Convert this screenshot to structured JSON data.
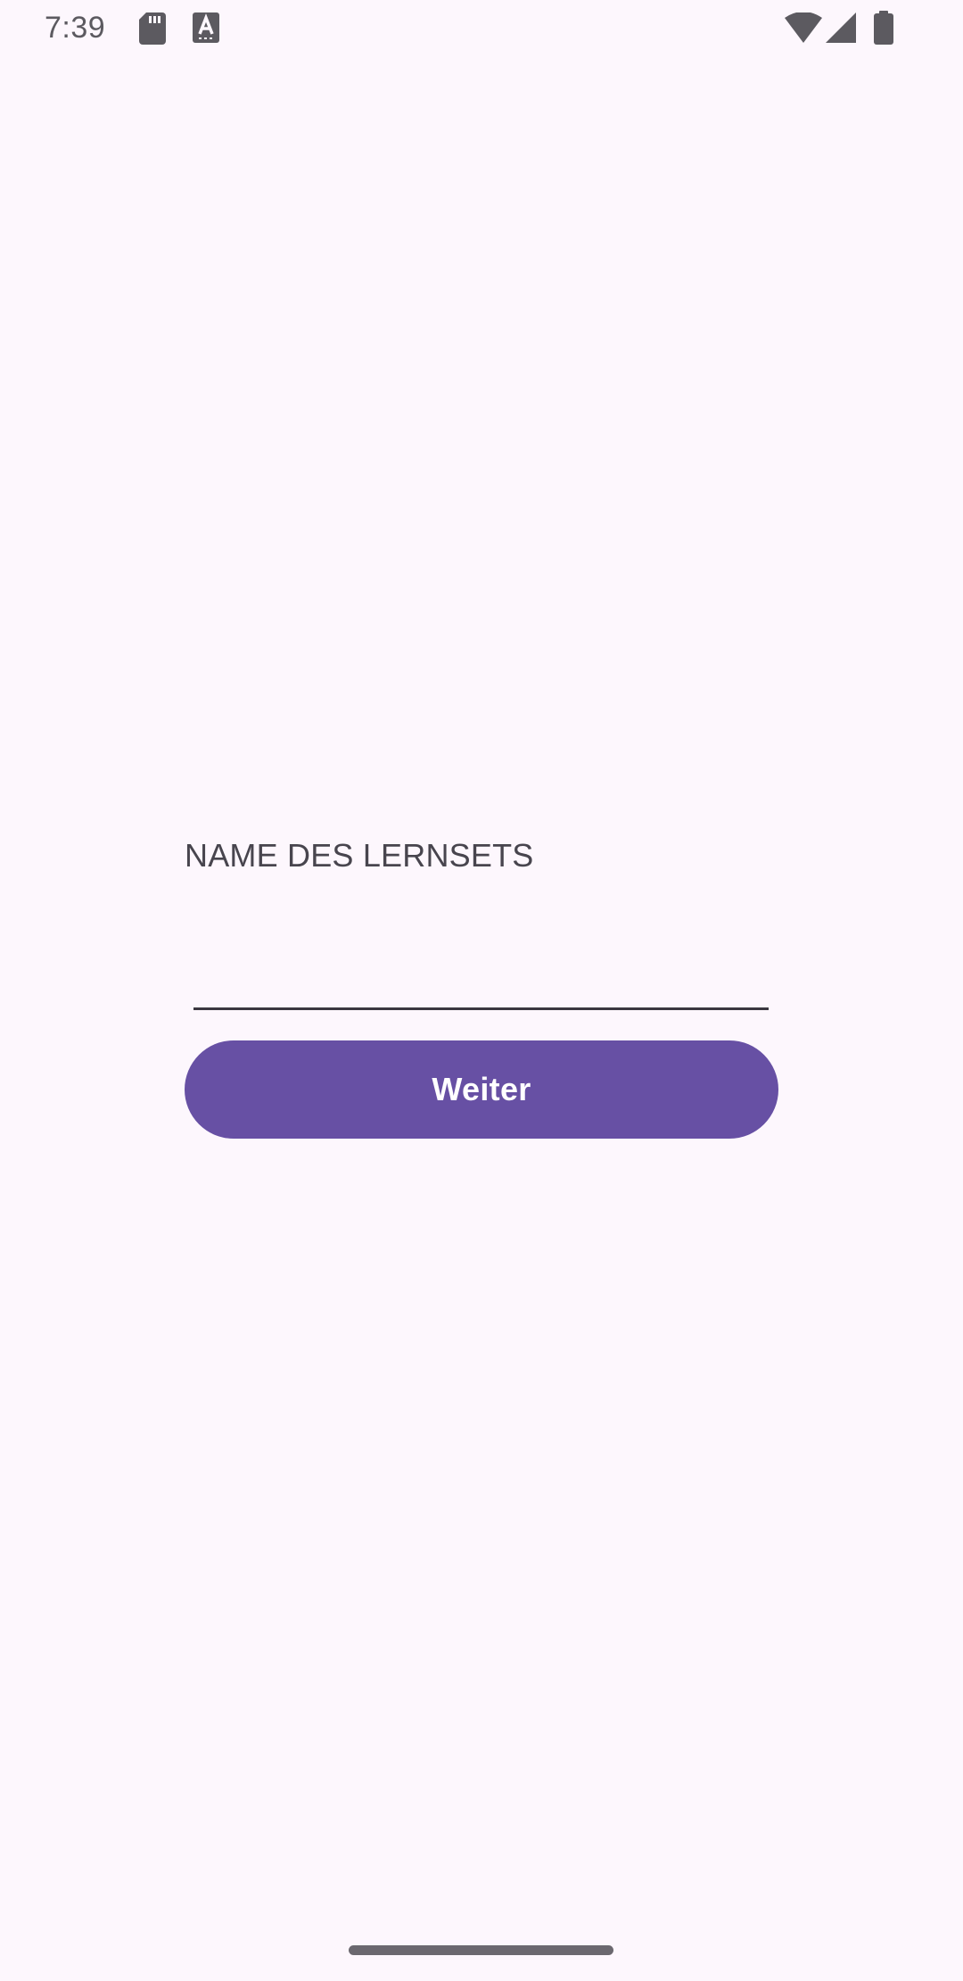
{
  "status_bar": {
    "time": "7:39",
    "icons": [
      "sd-card-icon",
      "a-notification-icon",
      "wifi-icon",
      "cellular-signal-icon",
      "battery-icon"
    ]
  },
  "form": {
    "label": "NAME DES LERNSETS",
    "input_value": "",
    "input_placeholder": "",
    "continue_label": "Weiter"
  },
  "colors": {
    "background": "#fdf7fd",
    "primary": "#6750a4",
    "on_primary": "#ffffff",
    "label_text": "#48454e"
  }
}
